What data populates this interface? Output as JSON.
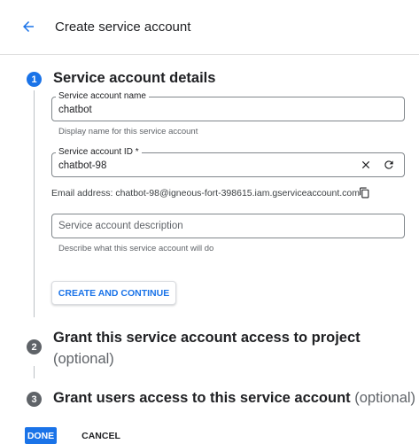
{
  "header": {
    "title": "Create service account"
  },
  "steps": [
    {
      "number": "1",
      "title": "Service account details"
    },
    {
      "number": "2",
      "title": "Grant this service account access to project",
      "optional": "(optional)"
    },
    {
      "number": "3",
      "title": "Grant users access to this service account",
      "optional": "(optional)"
    }
  ],
  "form": {
    "name": {
      "label": "Service account name",
      "value": "chatbot",
      "hint": "Display name for this service account"
    },
    "id": {
      "label": "Service account ID *",
      "value": "chatbot-98"
    },
    "email": "Email address: chatbot-98@igneous-fort-398615.iam.gserviceaccount.com",
    "description": {
      "placeholder": "Service account description",
      "hint": "Describe what this service account will do"
    },
    "create_button": "CREATE AND CONTINUE"
  },
  "footer": {
    "done_label": "DONE",
    "cancel_label": "CANCEL"
  },
  "colors": {
    "accent": "#1a73e8",
    "inactive_step": "#5f6368"
  }
}
